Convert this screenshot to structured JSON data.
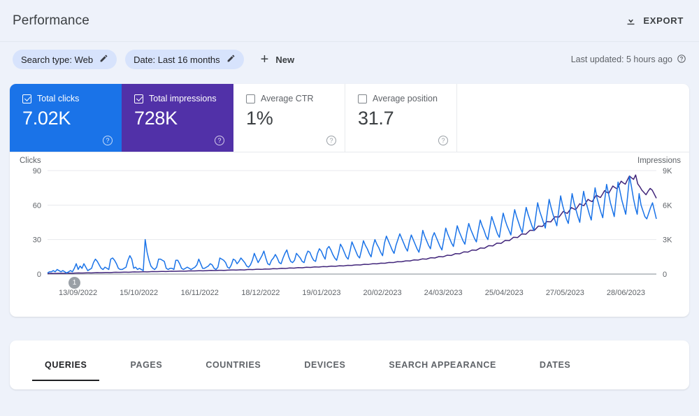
{
  "header": {
    "title": "Performance",
    "export_label": "EXPORT",
    "export_icon": "download-icon"
  },
  "filterbar": {
    "chips": [
      {
        "label": "Search type: Web",
        "icon": "pencil-icon"
      },
      {
        "label": "Date: Last 16 months",
        "icon": "pencil-icon"
      }
    ],
    "new_label": "New",
    "new_icon": "plus-icon",
    "last_updated": "Last updated: 5 hours ago",
    "help_icon": "help-icon"
  },
  "metrics": [
    {
      "label": "Total clicks",
      "value": "7.02K",
      "selected": true,
      "color": "#1a73e8",
      "help_icon": "help-icon"
    },
    {
      "label": "Total impressions",
      "value": "728K",
      "selected": true,
      "color": "#5131a8",
      "help_icon": "help-icon"
    },
    {
      "label": "Average CTR",
      "value": "1%",
      "selected": false,
      "color": "#ffffff",
      "help_icon": "help-icon"
    },
    {
      "label": "Average position",
      "value": "31.7",
      "selected": false,
      "color": "#ffffff",
      "help_icon": "help-icon"
    }
  ],
  "chart_data": {
    "type": "line",
    "title": "",
    "left_axis_label": "Clicks",
    "right_axis_label": "Impressions",
    "left_ticks": [
      "0",
      "30",
      "60",
      "90"
    ],
    "right_ticks": [
      "0",
      "3K",
      "6K",
      "9K"
    ],
    "left_ylim": [
      0,
      90
    ],
    "right_ylim": [
      0,
      9000
    ],
    "grid": true,
    "legend": "none",
    "annotations": [
      {
        "id": "1",
        "x_index": 9
      }
    ],
    "x_tick_labels": [
      "13/09/2022",
      "15/10/2022",
      "16/11/2022",
      "18/12/2022",
      "19/01/2023",
      "20/02/2023",
      "24/03/2023",
      "25/04/2023",
      "27/05/2023",
      "28/06/2023"
    ],
    "series": [
      {
        "name": "Clicks",
        "color": "#1a73e8",
        "axis": "left",
        "values": [
          1,
          2,
          2,
          3,
          2,
          4,
          3,
          2,
          3,
          2,
          1,
          2,
          3,
          2,
          5,
          9,
          4,
          7,
          5,
          9,
          6,
          3,
          4,
          5,
          10,
          13,
          11,
          8,
          5,
          4,
          6,
          5,
          4,
          13,
          14,
          12,
          9,
          5,
          4,
          4,
          5,
          6,
          12,
          16,
          13,
          5,
          6,
          4,
          5,
          4,
          3,
          30,
          19,
          12,
          7,
          5,
          4,
          6,
          13,
          13,
          12,
          11,
          5,
          4,
          5,
          5,
          4,
          12,
          12,
          9,
          5,
          4,
          5,
          6,
          5,
          4,
          5,
          6,
          8,
          13,
          9,
          5,
          5,
          6,
          7,
          9,
          8,
          5,
          4,
          6,
          14,
          13,
          12,
          10,
          6,
          5,
          8,
          13,
          12,
          9,
          11,
          14,
          12,
          10,
          7,
          6,
          8,
          12,
          18,
          14,
          10,
          13,
          16,
          20,
          14,
          9,
          8,
          12,
          14,
          17,
          14,
          10,
          9,
          14,
          18,
          21,
          15,
          11,
          10,
          12,
          18,
          16,
          14,
          11,
          10,
          16,
          20,
          19,
          15,
          12,
          11,
          18,
          22,
          20,
          16,
          13,
          22,
          24,
          21,
          17,
          14,
          12,
          18,
          26,
          23,
          19,
          15,
          13,
          20,
          28,
          24,
          20,
          16,
          14,
          21,
          29,
          25,
          22,
          18,
          15,
          24,
          30,
          26,
          23,
          19,
          16,
          27,
          33,
          29,
          25,
          21,
          18,
          25,
          30,
          35,
          31,
          27,
          23,
          20,
          28,
          34,
          30,
          26,
          22,
          19,
          27,
          38,
          33,
          29,
          25,
          22,
          32,
          36,
          32,
          28,
          24,
          21,
          30,
          40,
          35,
          31,
          27,
          24,
          33,
          42,
          37,
          33,
          29,
          26,
          36,
          44,
          39,
          35,
          31,
          28,
          38,
          47,
          42,
          38,
          33,
          30,
          40,
          50,
          45,
          40,
          35,
          32,
          43,
          53,
          47,
          42,
          38,
          34,
          46,
          56,
          50,
          45,
          40,
          36,
          48,
          58,
          52,
          47,
          42,
          38,
          50,
          62,
          55,
          50,
          45,
          40,
          53,
          65,
          58,
          52,
          47,
          42,
          55,
          68,
          60,
          54,
          48,
          44,
          57,
          70,
          62,
          56,
          50,
          45,
          60,
          72,
          64,
          58,
          52,
          47,
          62,
          75,
          66,
          60,
          54,
          49,
          64,
          78,
          70,
          62,
          56,
          50,
          66,
          80,
          72,
          64,
          58,
          52,
          68,
          85,
          76,
          66,
          58,
          52,
          70,
          60,
          55,
          50,
          48,
          53,
          58,
          62,
          55,
          48
        ]
      },
      {
        "name": "Impressions",
        "color": "#41257a",
        "axis": "right",
        "values": [
          40,
          50,
          60,
          55,
          50,
          60,
          70,
          65,
          60,
          70,
          80,
          75,
          70,
          80,
          90,
          100,
          95,
          90,
          100,
          110,
          105,
          100,
          110,
          120,
          130,
          125,
          120,
          130,
          140,
          135,
          130,
          140,
          150,
          160,
          155,
          150,
          160,
          170,
          165,
          160,
          170,
          180,
          190,
          185,
          180,
          190,
          200,
          195,
          190,
          200,
          210,
          220,
          215,
          210,
          220,
          230,
          225,
          220,
          230,
          240,
          250,
          245,
          240,
          250,
          260,
          255,
          250,
          260,
          270,
          280,
          275,
          270,
          280,
          290,
          285,
          280,
          290,
          300,
          310,
          320,
          315,
          310,
          320,
          330,
          325,
          320,
          330,
          340,
          350,
          360,
          355,
          350,
          360,
          370,
          365,
          360,
          380,
          400,
          395,
          390,
          400,
          420,
          415,
          410,
          420,
          440,
          435,
          430,
          450,
          470,
          465,
          460,
          480,
          500,
          495,
          490,
          510,
          530,
          525,
          520,
          540,
          560,
          555,
          550,
          570,
          590,
          585,
          580,
          600,
          620,
          615,
          610,
          630,
          650,
          645,
          640,
          670,
          690,
          685,
          680,
          700,
          720,
          715,
          710,
          740,
          760,
          755,
          750,
          780,
          800,
          795,
          790,
          820,
          850,
          845,
          840,
          870,
          900,
          895,
          890,
          920,
          950,
          945,
          940,
          980,
          1010,
          1005,
          1000,
          1040,
          1080,
          1075,
          1070,
          1110,
          1150,
          1145,
          1140,
          1190,
          1230,
          1225,
          1220,
          1270,
          1320,
          1310,
          1300,
          1360,
          1420,
          1410,
          1400,
          1460,
          1520,
          1510,
          1500,
          1570,
          1640,
          1630,
          1620,
          1700,
          1780,
          1770,
          1760,
          1840,
          1930,
          1920,
          1910,
          2000,
          2090,
          2080,
          2070,
          2170,
          2270,
          2260,
          2250,
          2360,
          2470,
          2460,
          2450,
          2570,
          2690,
          2680,
          2670,
          2800,
          2930,
          2920,
          2910,
          3050,
          3200,
          3190,
          3180,
          3330,
          3490,
          3480,
          3470,
          3640,
          3810,
          3800,
          3790,
          3980,
          4170,
          4160,
          4150,
          4350,
          4560,
          4550,
          4540,
          4760,
          4980,
          4970,
          4960,
          5200,
          5450,
          5350,
          5280,
          5520,
          5780,
          5680,
          5600,
          5850,
          6120,
          6010,
          5950,
          6220,
          6500,
          6380,
          6300,
          6580,
          6880,
          6750,
          6660,
          6950,
          7260,
          7120,
          7030,
          7340,
          7660,
          7520,
          7420,
          7750,
          8080,
          7930,
          7820,
          8180,
          8530,
          8370,
          8240,
          8620,
          7850,
          7600,
          7300,
          7100,
          6900,
          7200,
          7450,
          7300,
          6950,
          6600
        ]
      }
    ]
  },
  "tabs": [
    {
      "label": "QUERIES",
      "active": true
    },
    {
      "label": "PAGES",
      "active": false
    },
    {
      "label": "COUNTRIES",
      "active": false
    },
    {
      "label": "DEVICES",
      "active": false
    },
    {
      "label": "SEARCH APPEARANCE",
      "active": false
    },
    {
      "label": "DATES",
      "active": false
    }
  ]
}
